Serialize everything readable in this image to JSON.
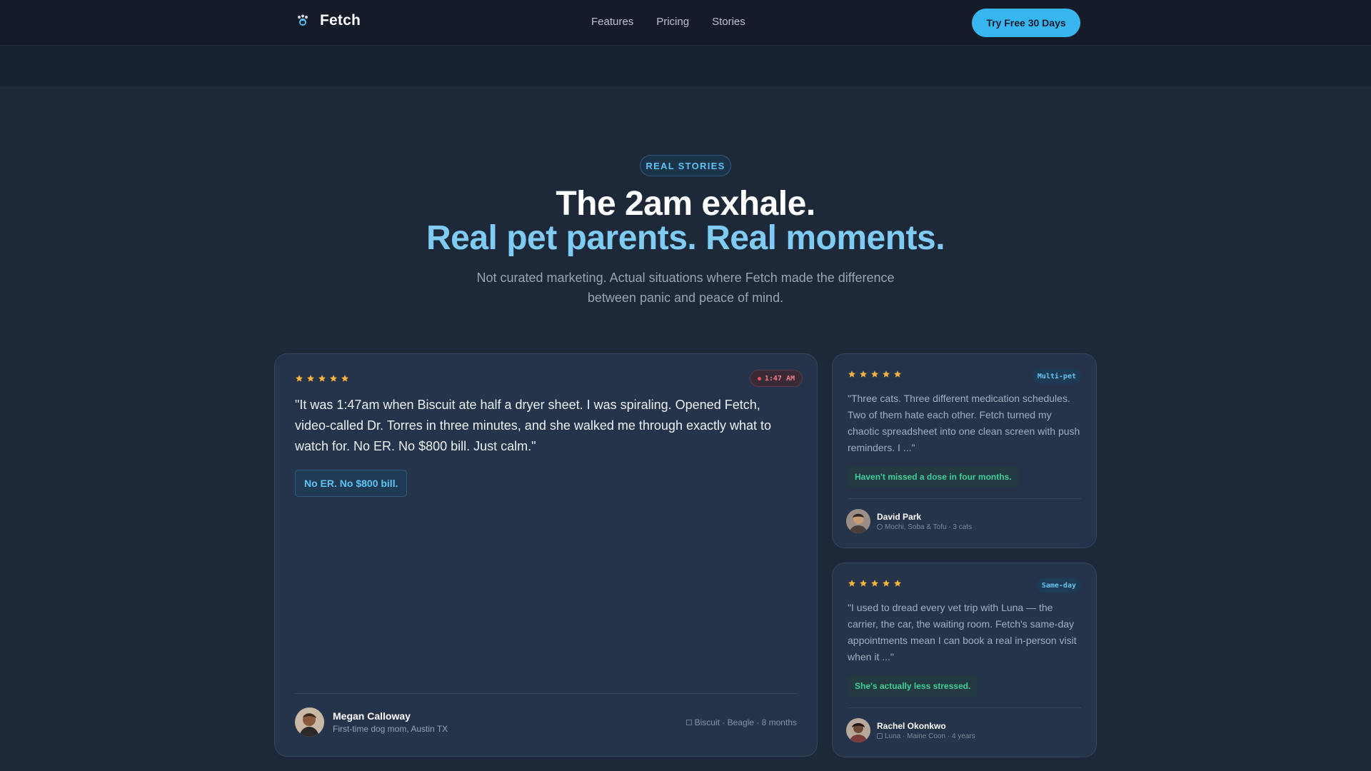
{
  "header": {
    "brand": "Fetch",
    "nav": [
      "Features",
      "Pricing",
      "Stories"
    ],
    "cta": "Try Free 30 Days"
  },
  "hero": {
    "badge": "REAL STORIES",
    "title_line1": "The 2am exhale.",
    "title_line2": "Real pet parents. Real moments.",
    "lead": "Not curated marketing. Actual situations where Fetch made the difference between panic and peace of mind."
  },
  "colors": {
    "accent": "#38b6f0",
    "highlight": "#7fcbf2",
    "stars": "#f6b73c",
    "success": "#3ecf9a",
    "alert": "#f07c8a"
  },
  "featured": {
    "rating": 5,
    "time": "1:47 AM",
    "quote": "\"It was 1:47am when Biscuit ate half a dryer sheet. I was spiraling. Opened Fetch, video-called Dr. Torres in three minutes, and she walked me through exactly what to watch for. No ER. No $800 bill. Just calm.\"",
    "result": "No ER. No $800 bill.",
    "author": {
      "name": "Megan Calloway",
      "subtitle": "First-time dog mom, Austin TX",
      "pet": "Biscuit · Beagle · 8 months"
    }
  },
  "stories": [
    {
      "rating": 5,
      "tag": "Multi-pet",
      "quote": "\"Three cats. Three different medication schedules. Two of them hate each other. Fetch turned my chaotic spreadsheet into one clean screen with push reminders. I ...\"",
      "result": "Haven't missed a dose in four months.",
      "author": {
        "name": "David Park",
        "pet": "Mochi, Soba & Tofu · 3 cats"
      }
    },
    {
      "rating": 5,
      "tag": "Same-day",
      "quote": "\"I used to dread every vet trip with Luna — the carrier, the car, the waiting room. Fetch's same-day appointments mean I can book a real in-person visit when it ...\"",
      "result": "She's actually less stressed.",
      "author": {
        "name": "Rachel Okonkwo",
        "pet": "Luna · Maine Coon · 4 years"
      }
    }
  ]
}
